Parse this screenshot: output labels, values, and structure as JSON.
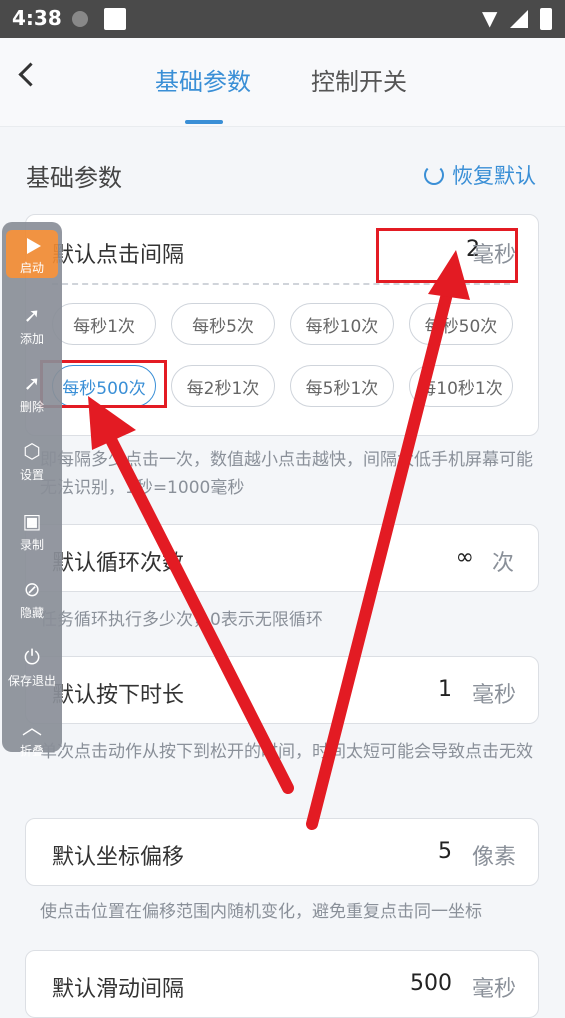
{
  "status": {
    "time": "4:38"
  },
  "header": {
    "tabs": [
      {
        "label": "基础参数"
      },
      {
        "label": "控制开关"
      }
    ]
  },
  "section": {
    "title": "基础参数",
    "reset_label": "恢复默认"
  },
  "click_interval": {
    "label": "默认点击间隔",
    "value": "2",
    "unit": "毫秒",
    "presets": [
      "每秒1次",
      "每秒5次",
      "每秒10次",
      "每秒50次",
      "每秒500次",
      "每2秒1次",
      "每5秒1次",
      "每10秒1次"
    ],
    "selected_preset": "每秒500次",
    "hint": "即每隔多少点击一次，数值越小点击越快，间隔太低手机屏幕可能无法识别，1秒=1000毫秒"
  },
  "loop_count": {
    "label": "默认循环次数",
    "value": "∞",
    "unit": "次",
    "hint": "任务循环执行多少次，0表示无限循环"
  },
  "press_duration": {
    "label": "默认按下时长",
    "value": "1",
    "unit": "毫秒",
    "hint": "单次点击动作从按下到松开的时间，时间太短可能会导致点击无效"
  },
  "coord_offset": {
    "label": "默认坐标偏移",
    "value": "5",
    "unit": "像素",
    "hint": "使点击位置在偏移范围内随机变化，避免重复点击同一坐标"
  },
  "swipe_interval": {
    "label": "默认滑动间隔",
    "value": "500",
    "unit": "毫秒"
  },
  "floatbar": {
    "items": [
      {
        "label": "启动",
        "icon": "play-icon"
      },
      {
        "label": "添加",
        "icon": "add-pointer-icon"
      },
      {
        "label": "删除",
        "icon": "remove-pointer-icon"
      },
      {
        "label": "设置",
        "icon": "settings-icon"
      },
      {
        "label": "录制",
        "icon": "record-icon"
      },
      {
        "label": "隐藏",
        "icon": "hide-icon"
      },
      {
        "label": "保存退出",
        "icon": "power-icon"
      },
      {
        "label": "折叠",
        "icon": "chevron-up-icon"
      }
    ]
  },
  "colors": {
    "accent": "#3a8fd6",
    "annotation": "#e31b23",
    "start_button": "#f08a32"
  }
}
